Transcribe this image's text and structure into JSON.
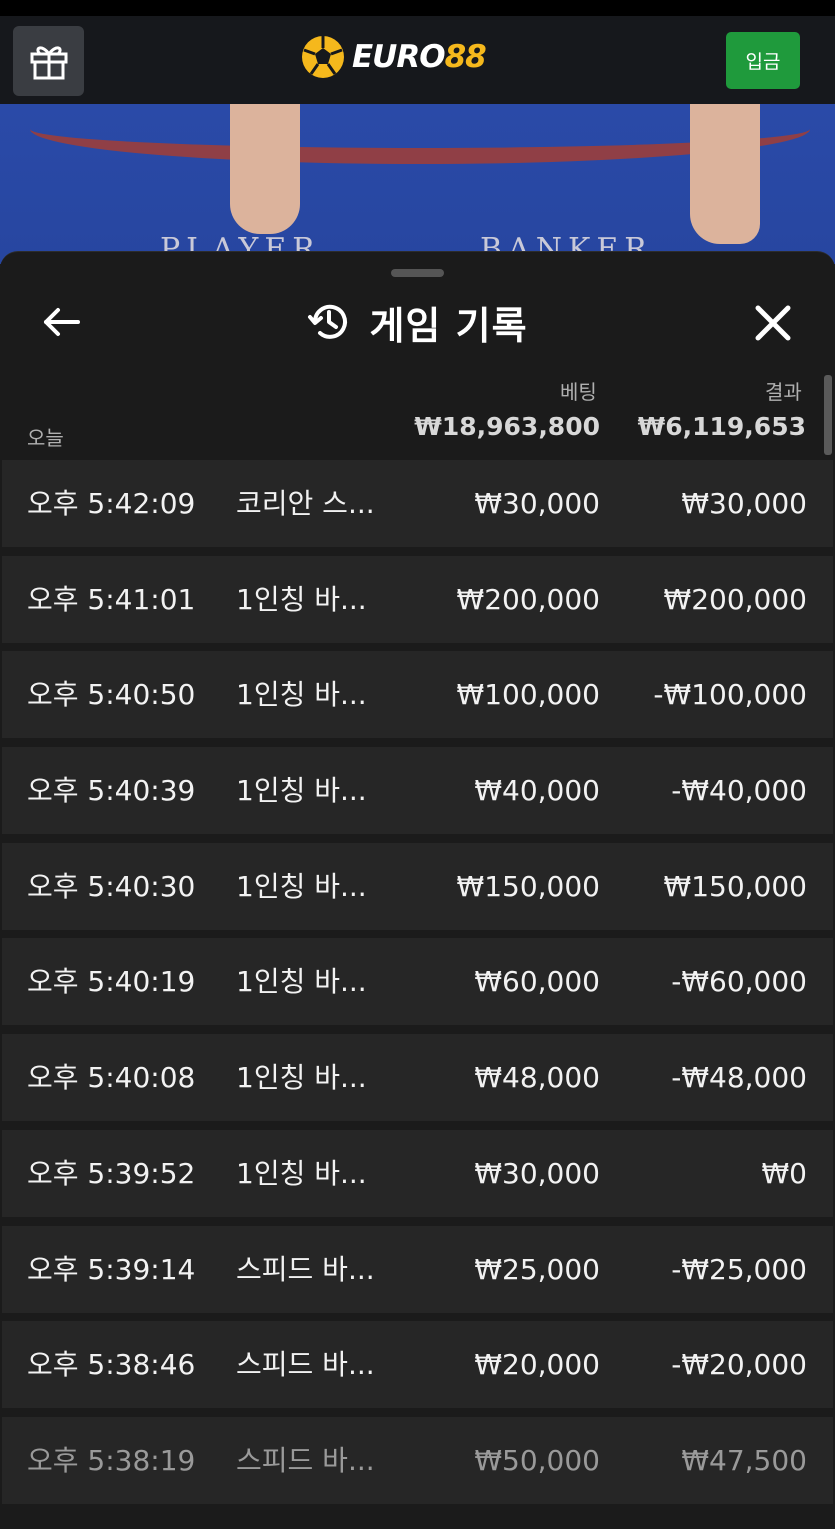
{
  "header": {
    "logo_text_white": "EURO",
    "logo_text_gold": "88",
    "deposit_label": "입금"
  },
  "background": {
    "left_text": "PLAYER",
    "right_text": "BANKER"
  },
  "sheet": {
    "title": "게임 기록",
    "bet_header": "베팅",
    "result_header": "결과",
    "today_label": "오늘",
    "total_bet": "₩18,963,800",
    "total_result": "₩6,119,653"
  },
  "rows": [
    {
      "time": "오후 5:42:09",
      "game": "코리안 스...",
      "bet": "₩30,000",
      "result": "₩30,000"
    },
    {
      "time": "오후 5:41:01",
      "game": "1인칭 바...",
      "bet": "₩200,000",
      "result": "₩200,000"
    },
    {
      "time": "오후 5:40:50",
      "game": "1인칭 바...",
      "bet": "₩100,000",
      "result": "-₩100,000"
    },
    {
      "time": "오후 5:40:39",
      "game": "1인칭 바...",
      "bet": "₩40,000",
      "result": "-₩40,000"
    },
    {
      "time": "오후 5:40:30",
      "game": "1인칭 바...",
      "bet": "₩150,000",
      "result": "₩150,000"
    },
    {
      "time": "오후 5:40:19",
      "game": "1인칭 바...",
      "bet": "₩60,000",
      "result": "-₩60,000"
    },
    {
      "time": "오후 5:40:08",
      "game": "1인칭 바...",
      "bet": "₩48,000",
      "result": "-₩48,000"
    },
    {
      "time": "오후 5:39:52",
      "game": "1인칭 바...",
      "bet": "₩30,000",
      "result": "₩0"
    },
    {
      "time": "오후 5:39:14",
      "game": "스피드 바...",
      "bet": "₩25,000",
      "result": "-₩25,000"
    },
    {
      "time": "오후 5:38:46",
      "game": "스피드 바...",
      "bet": "₩20,000",
      "result": "-₩20,000"
    },
    {
      "time": "오후 5:38:19",
      "game": "스피드 바...",
      "bet": "₩50,000",
      "result": "₩47,500"
    }
  ],
  "colors": {
    "deposit_green": "#1f9a3c",
    "logo_gold": "#f5b81c",
    "row_bg": "#262626"
  }
}
